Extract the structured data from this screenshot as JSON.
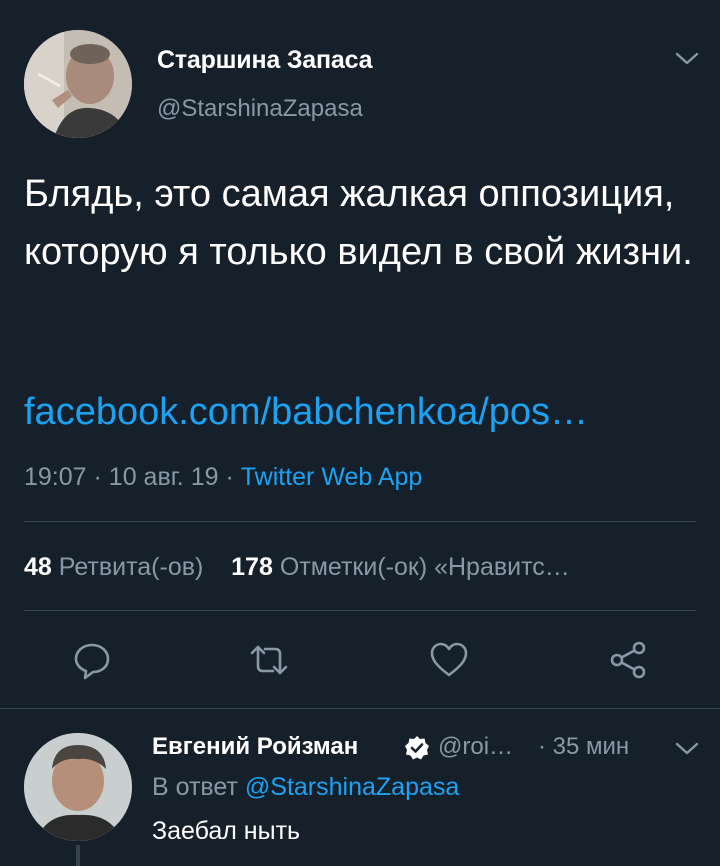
{
  "colors": {
    "background": "#15202b",
    "accent": "#1da1f2",
    "secondary_text": "#8899a6",
    "divider": "#38444d"
  },
  "tweet": {
    "author_name": "Старшина Запаса",
    "author_handle": "@StarshinaZapasa",
    "text": "Блядь, это самая жалкая оппозиция, которую я только видел в свой жизни.",
    "link": "facebook.com/babchenkoa/pos…",
    "time": "19:07",
    "date": "10 авг. 19",
    "source": "Twitter Web App",
    "retweets_count": "48",
    "retweets_label": "Ретвита(-ов)",
    "likes_count": "178",
    "likes_label": "Отметки(-ок) «Нравитс…"
  },
  "icons": {
    "more": "chevron-down-icon",
    "reply": "reply-icon",
    "retweet": "retweet-icon",
    "like": "heart-icon",
    "share": "share-icon",
    "verified": "verified-badge-icon"
  },
  "reply": {
    "author_name": "Евгений Ройзман",
    "author_handle": "@roi…",
    "time": "· 35 мин",
    "reply_prefix": "В ответ",
    "reply_to": "@StarshinaZapasa",
    "text": "Заебал ныть"
  }
}
